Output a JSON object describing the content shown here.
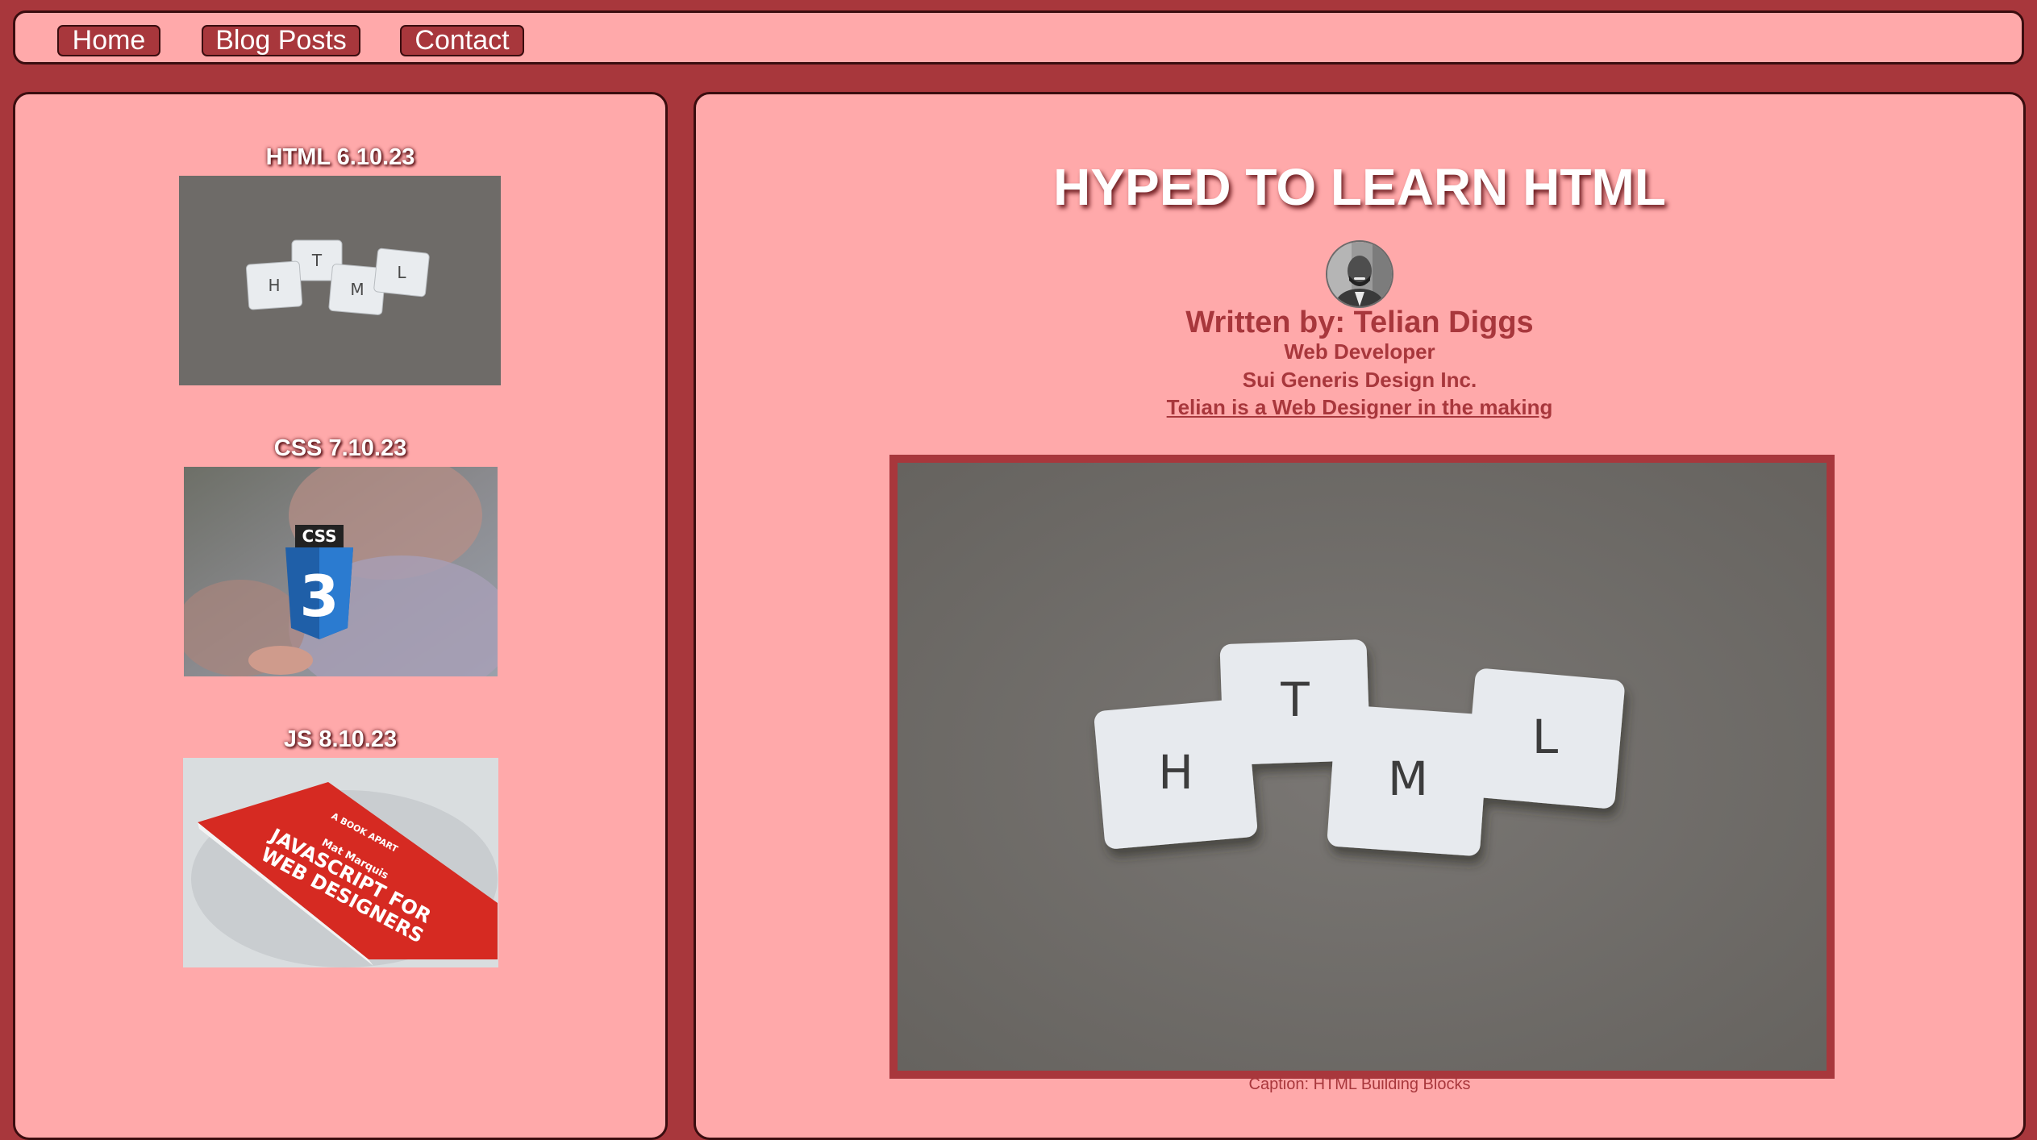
{
  "nav": {
    "home": "Home",
    "blog_posts": "Blog Posts",
    "contact": "Contact"
  },
  "sidebar": {
    "posts": [
      {
        "title": "HTML 6.10.23",
        "image": "html-tiles-photo"
      },
      {
        "title": "CSS 7.10.23",
        "image": "css3-logo-photo"
      },
      {
        "title": "JS 8.10.23",
        "image": "javascript-book-photo"
      }
    ]
  },
  "article": {
    "headline": "HYPED TO LEARN HTML",
    "author_line": "Written by: Telian Diggs",
    "role": "Web Developer",
    "company": "Sui Generis Design Inc.",
    "tagline": "Telian is a Web Designer in the making",
    "caption": "Caption: HTML Building Blocks"
  },
  "images": {
    "tiles_letters": [
      "H",
      "T",
      "M",
      "L"
    ],
    "css_logo": "CSS",
    "css_number": "3",
    "book_title_line1": "JAVASCRIPT FOR",
    "book_title_line2": "WEB DESIGNERS",
    "book_author": "Mat Marquis",
    "book_series": "A BOOK APART"
  },
  "colors": {
    "page_bg": "#a8373c",
    "panel_bg": "#ffa9aa",
    "border": "#3a0d0f",
    "accent": "#a8373c"
  }
}
